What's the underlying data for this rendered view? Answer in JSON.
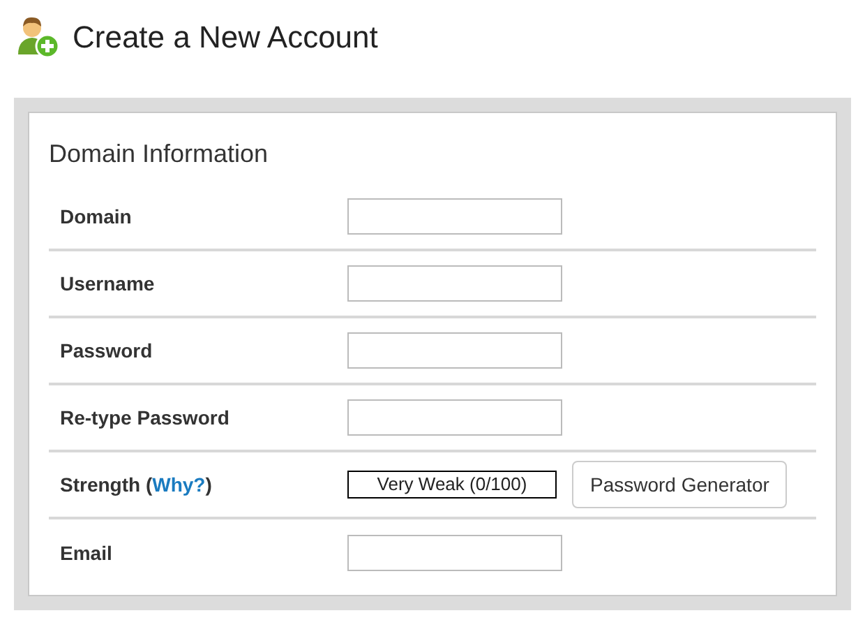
{
  "page": {
    "title": "Create a New Account"
  },
  "section": {
    "title": "Domain Information",
    "rows": [
      {
        "kind": "input",
        "label": "Domain"
      },
      {
        "kind": "input",
        "label": "Username"
      },
      {
        "kind": "input",
        "label": "Password"
      },
      {
        "kind": "input",
        "label": "Re-type Password"
      },
      {
        "kind": "strength",
        "label": "Strength (",
        "link": "Why?",
        "label_end": ")",
        "meter": "Very Weak (0/100)",
        "button": "Password Generator"
      },
      {
        "kind": "input",
        "label": "Email"
      }
    ]
  }
}
